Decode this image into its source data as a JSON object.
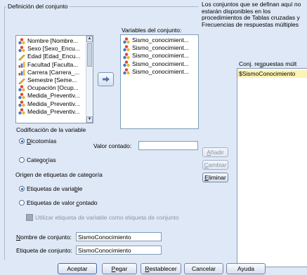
{
  "definition_group": {
    "legend": "Definición del conjunto",
    "source_items": [
      {
        "label": "Nombre [Nombre...",
        "icon": "nominal-icon"
      },
      {
        "label": "Sexo [Sexo_Encu...",
        "icon": "nominal-icon"
      },
      {
        "label": "Edad [Edad_Encu...",
        "icon": "scale-icon"
      },
      {
        "label": "Facultad [Faculta...",
        "icon": "ordinal-icon"
      },
      {
        "label": "Carrera [Carrera_...",
        "icon": "ordinal-icon"
      },
      {
        "label": "Semestre [Seme...",
        "icon": "scale-icon"
      },
      {
        "label": "Ocupación [Ocup...",
        "icon": "nominal-icon"
      },
      {
        "label": "Medida_Preventiv...",
        "icon": "nominal-icon"
      },
      {
        "label": "Medida_Preventiv...",
        "icon": "nominal-icon"
      },
      {
        "label": "Medida_Preventiv...",
        "icon": "nominal-icon"
      }
    ],
    "move_button_icon": "arrow-right-icon",
    "set_variables_label": "Variables del conjunto:",
    "set_variables": [
      {
        "label": "Sismo_conocimient...",
        "icon": "nominal-icon"
      },
      {
        "label": "Sismo_conocimient...",
        "icon": "nominal-icon"
      },
      {
        "label": "Sismo_conocimient...",
        "icon": "nominal-icon"
      },
      {
        "label": "Sismo_conocimient...",
        "icon": "nominal-icon"
      },
      {
        "label": "Sismo_conocimient...",
        "icon": "nominal-icon"
      }
    ],
    "coding_label": "Codificación de la variable",
    "radio_dichotomies": {
      "pre": "",
      "u": "D",
      "post": "icotomías"
    },
    "counted_value_label": "Valor contado:",
    "counted_value": "",
    "radio_categories": {
      "pre": "Catego",
      "u": "r",
      "post": "ías"
    },
    "category_labels_origin": "Origen de etiquetas de categoría",
    "radio_var_labels": {
      "pre": "Etiquetas de varia",
      "u": "b",
      "post": "le"
    },
    "radio_counted_values": {
      "pre": "Etiquetas de valor ",
      "u": "c",
      "post": "ontado"
    },
    "checkbox_use_label": "Utilizar etiqueta de variable como etiqueta de conjunto",
    "set_name_label": {
      "pre": "",
      "u": "N",
      "post": "ombre de conjunto:"
    },
    "set_name": "SismoConocimiento",
    "set_label_label": {
      "pre": "Etiqueta de conjunto:",
      "u": "",
      "post": ""
    },
    "set_label": "SismoConocimiento"
  },
  "info_text": [
    "Los conjuntos que se definan aquí no",
    "estarán disponibles en los",
    "procedimientos de Tablas cruzadas y",
    "Frecuencias de respuestas múltiples"
  ],
  "response_sets": {
    "label": {
      "pre": "Conj. re",
      "u": "s",
      "post": "puestas múlt"
    },
    "items": [
      "$SismoConocimiento"
    ]
  },
  "side_buttons": {
    "add": {
      "pre": "",
      "u": "A",
      "post": "ñadir"
    },
    "change": {
      "pre": "",
      "u": "C",
      "post": "ambiar"
    },
    "remove": {
      "pre": "",
      "u": "E",
      "post": "liminar"
    }
  },
  "footer_buttons": {
    "ok": "Aceptar",
    "paste": {
      "pre": "",
      "u": "P",
      "post": "egar"
    },
    "reset": {
      "pre": "",
      "u": "R",
      "post": "establecer"
    },
    "cancel": "Cancelar",
    "help": "Ayuda"
  },
  "colors": {
    "background": "#dfe8f6",
    "selection": "#fdf3b3",
    "accent": "#2b5cb0"
  }
}
